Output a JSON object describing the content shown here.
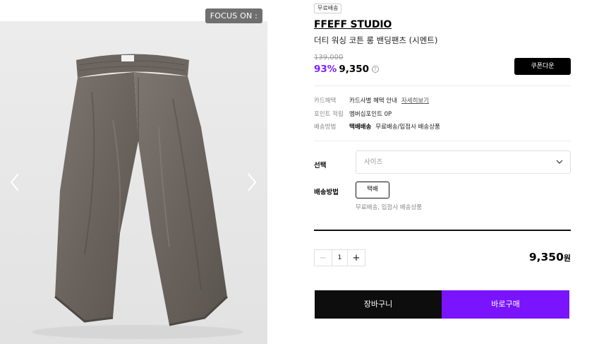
{
  "gallery": {
    "focus_badge": "FOCUS ON :",
    "background": "#e6e6e6"
  },
  "product": {
    "tag": "무료배송",
    "brand": "FFEFF STUDIO",
    "name": "더티 워싱 코튼 롱 밴딩팬츠 (시멘트)",
    "original_price": "139,000",
    "discount": "93%",
    "price": "9,350",
    "price_info_icon": "question-icon",
    "coupon_button": "쿠폰다운"
  },
  "details": {
    "card_label": "카드혜택",
    "card_value": "카드사별 혜택 안내",
    "card_link": "자세히보기",
    "point_label": "포인트 적립",
    "point_value": "멤버십포인트 0P",
    "ship_label": "배송방법",
    "ship_method": "택배배송",
    "ship_desc": "무료배송/입점사 배송상품"
  },
  "options": {
    "select_label": "선택",
    "size_placeholder": "사이즈",
    "shipping_label": "배송방법",
    "shipping_option": "택배",
    "shipping_note": "무료배송, 입점사 배송상품"
  },
  "order": {
    "quantity": "1",
    "minus": "−",
    "plus": "+",
    "total": "9,350",
    "currency": "원",
    "cart_button": "장바구니",
    "buy_button": "바로구매"
  },
  "colors": {
    "accent": "#7a14ff",
    "dark": "#0d0d0d"
  }
}
